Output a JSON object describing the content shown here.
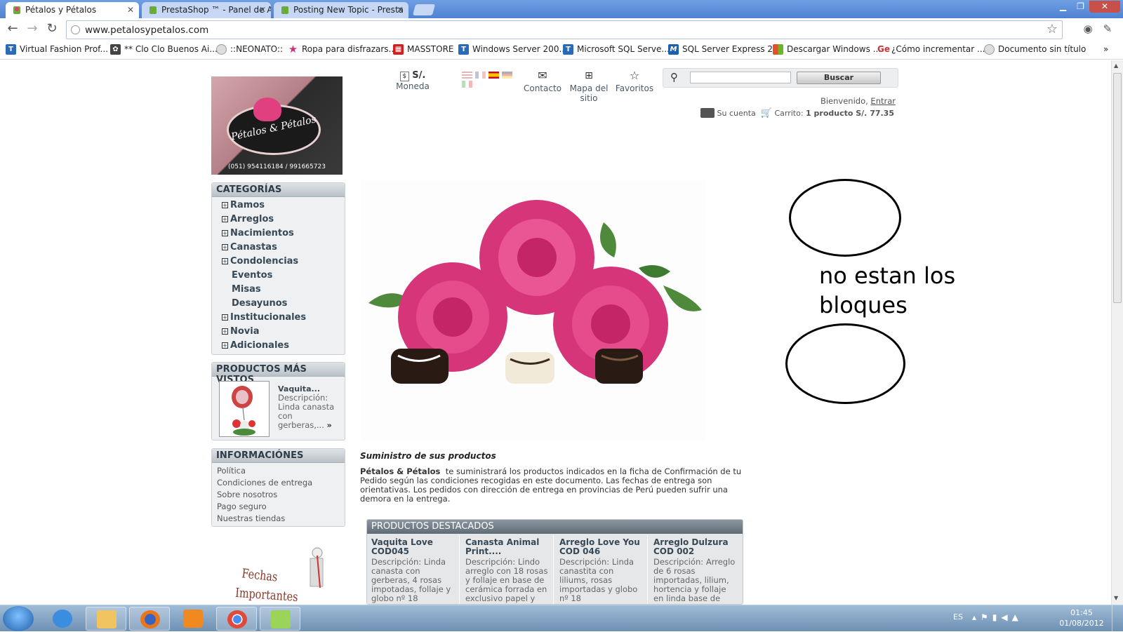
{
  "browser": {
    "tabs": [
      {
        "title": "Pétalos y Pétalos"
      },
      {
        "title": "PrestaShop ™ - Panel de Ad"
      },
      {
        "title": "Posting New Topic - Presta"
      }
    ],
    "url": "www.petalosypetalos.com",
    "bookmarks": [
      "Virtual Fashion Prof...",
      "** Clo Clo Buenos Ai...",
      "::NEONATO::",
      "Ropa para disfrazars...",
      "MASSTORE",
      "Windows Server 200...",
      "Microsoft SQL Serve...",
      "SQL Server Express 2...",
      "Descargar Windows ...",
      "¿Cómo incrementar ...",
      "Documento sin título"
    ]
  },
  "site": {
    "logo": {
      "name": "Pétalos & Pétalos",
      "phone": "(051) 954116184 / 991665723"
    },
    "header": {
      "currency_symbol": "S/.",
      "currency_label": "Moneda",
      "contact": "Contacto",
      "sitemap_line1": "Mapa del",
      "sitemap_line2": "sitio",
      "favorites": "Favoritos",
      "search_button": "Buscar",
      "welcome": "Bienvenido,",
      "login": "Entrar",
      "account": "Su cuenta",
      "cart_label": "Carrito:",
      "cart_value": "1 producto S/. 77.35"
    },
    "categories": {
      "title": "CATEGORÍAS",
      "items": [
        "Ramos",
        "Arreglos",
        "Nacimientos",
        "Canastas",
        "Condolencias",
        "Eventos",
        "Misas",
        "Desayunos",
        "Institucionales",
        "Novia",
        "Adicionales"
      ]
    },
    "most_viewed": {
      "title": "PRODUCTOS MÁS VISTOS",
      "name": "Vaquita...",
      "desc_line1": "Descripción:",
      "desc_line2": "Linda canasta",
      "desc_line3": "con",
      "desc_line4": "gerberas,...",
      "more": "»"
    },
    "info": {
      "title": "INFORMACIÓNES",
      "items": [
        "Política",
        "Condiciones de entrega",
        "Sobre nosotros",
        "Pago seguro",
        "Nuestras tiendas"
      ]
    },
    "promo": {
      "line1": "Fechas",
      "line2": "Importantes"
    },
    "content": {
      "heading": "Suministro de sus productos",
      "brand": "Pétalos & Pétalos",
      "body": "te suministrará los productos indicados en la ficha de Confirmación de tu Pedido según las condiciones recogidas en este documento. Las fechas de entrega son orientativas. Los pedidos con dirección de entrega en provincias de Perú pueden sufrir una demora en la entrega."
    },
    "featured": {
      "title": "PRODUCTOS DESTACADOS",
      "items": [
        {
          "name": "Vaquita Love COD045",
          "desc": "Descripción: Linda canasta con gerberas, 4 rosas impotadas, follaje y globo nº 18"
        },
        {
          "name": "Canasta Animal Print....",
          "desc": "Descripción: Lindo arreglo con 18 rosas y follaje en base de cerámica forrada en exclusivo papel y"
        },
        {
          "name": "Arreglo Love You COD 046",
          "desc": "Descripción: Linda canastita con liliums, rosas importadas y globo nº 18"
        },
        {
          "name": "Arreglo Dulzura COD 002",
          "desc": "Descripción: Arreglo de 6 rosas importadas, lilium, hortencia y follaje en linda base de"
        }
      ]
    },
    "annotation": {
      "line1": "no estan los",
      "line2": "bloques"
    }
  },
  "taskbar": {
    "lang": "ES",
    "time": "01:45",
    "date": "01/08/2012"
  }
}
